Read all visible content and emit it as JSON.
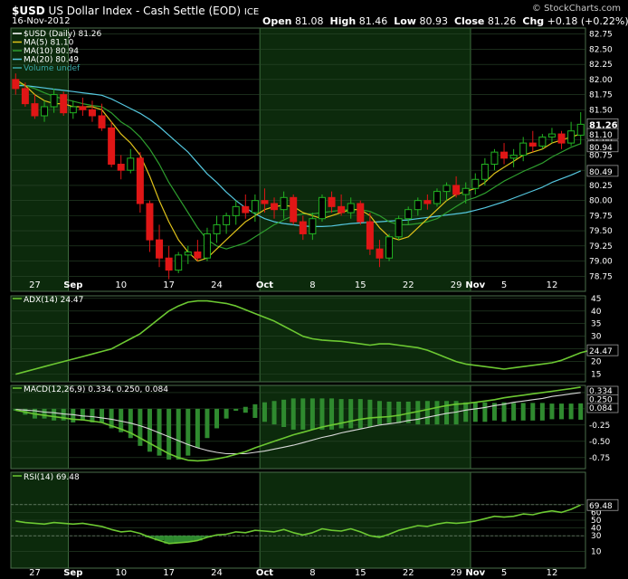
{
  "header": {
    "symbol": "$USD",
    "name": "US Dollar Index - Cash Settle (EOD)",
    "exchange": "ICE",
    "date": "16-Nov-2012",
    "open_label": "Open",
    "open_value": "81.08",
    "high_label": "High",
    "high_value": "81.46",
    "low_label": "Low",
    "low_value": "80.93",
    "close_label": "Close",
    "close_value": "81.26",
    "chg_label": "Chg",
    "chg_value": "+0.18 (+0.22%)",
    "watermark": "© StockCharts.com"
  },
  "colors": {
    "up": "#22b422",
    "down": "#e01616",
    "ma5": "#e0c21a",
    "ma10": "#2e9e2e",
    "ma20": "#55c8e0",
    "indicator": "#6cc832",
    "signal": "#d8d8d8",
    "grid": "#2a472a",
    "shade": "#0c2a0c"
  },
  "chart_data": [
    {
      "type": "candlestick",
      "title": "$USD (Daily) 81.26",
      "legend": [
        {
          "label": "$USD (Daily) 81.26",
          "color": "#ffffff"
        },
        {
          "label": "MA(5) 81.10",
          "color": "#e0c21a"
        },
        {
          "label": "MA(10) 80.94",
          "color": "#2e9e2e"
        },
        {
          "label": "MA(20) 80.49",
          "color": "#55c8e0"
        },
        {
          "label": "Volume undef",
          "color": "#3aa6a6"
        }
      ],
      "ylim": [
        78.5,
        82.85
      ],
      "yticks": [
        "82.75",
        "82.50",
        "82.25",
        "82.00",
        "81.75",
        "81.50",
        "81.25",
        "81.00",
        "80.75",
        "80.50",
        "80.25",
        "80.00",
        "79.75",
        "79.50",
        "79.25",
        "79.00",
        "78.75"
      ],
      "value_tags": [
        {
          "label": "81.26",
          "value": 81.26,
          "bold": true
        },
        {
          "label": "81.10",
          "value": 81.1
        },
        {
          "label": "80.94",
          "value": 80.94
        },
        {
          "label": "80.49",
          "value": 80.49
        }
      ],
      "x_labels": [
        {
          "label": "27",
          "i": 2
        },
        {
          "label": "Sep",
          "i": 6
        },
        {
          "label": "10",
          "i": 11
        },
        {
          "label": "17",
          "i": 16
        },
        {
          "label": "24",
          "i": 21
        },
        {
          "label": "Oct",
          "i": 26
        },
        {
          "label": "8",
          "i": 31
        },
        {
          "label": "15",
          "i": 36
        },
        {
          "label": "22",
          "i": 41
        },
        {
          "label": "29",
          "i": 46
        },
        {
          "label": "Nov",
          "i": 48
        },
        {
          "label": "5",
          "i": 51
        },
        {
          "label": "12",
          "i": 56
        }
      ],
      "ohlc": [
        [
          82.0,
          82.1,
          81.75,
          81.85
        ],
        [
          81.85,
          81.95,
          81.55,
          81.6
        ],
        [
          81.6,
          81.75,
          81.35,
          81.4
        ],
        [
          81.4,
          81.65,
          81.3,
          81.55
        ],
        [
          81.55,
          81.85,
          81.45,
          81.75
        ],
        [
          81.75,
          81.8,
          81.4,
          81.45
        ],
        [
          81.45,
          81.65,
          81.35,
          81.55
        ],
        [
          81.55,
          81.7,
          81.4,
          81.5
        ],
        [
          81.5,
          81.65,
          81.3,
          81.4
        ],
        [
          81.4,
          81.6,
          81.15,
          81.2
        ],
        [
          81.2,
          81.3,
          80.55,
          80.6
        ],
        [
          80.6,
          80.75,
          80.35,
          80.5
        ],
        [
          80.5,
          80.85,
          80.45,
          80.7
        ],
        [
          80.7,
          80.8,
          79.8,
          79.95
        ],
        [
          79.95,
          80.0,
          79.15,
          79.35
        ],
        [
          79.35,
          79.6,
          78.9,
          79.05
        ],
        [
          79.05,
          79.25,
          78.7,
          78.85
        ],
        [
          78.85,
          79.15,
          78.8,
          79.1
        ],
        [
          79.1,
          79.25,
          78.95,
          79.15
        ],
        [
          79.15,
          79.35,
          79.0,
          79.05
        ],
        [
          79.05,
          79.55,
          79.0,
          79.45
        ],
        [
          79.45,
          79.75,
          79.3,
          79.6
        ],
        [
          79.6,
          79.8,
          79.45,
          79.75
        ],
        [
          79.75,
          80.0,
          79.6,
          79.9
        ],
        [
          79.9,
          80.1,
          79.7,
          79.8
        ],
        [
          79.8,
          80.1,
          79.65,
          80.0
        ],
        [
          80.0,
          80.2,
          79.8,
          79.95
        ],
        [
          79.95,
          80.05,
          79.7,
          79.85
        ],
        [
          79.85,
          80.15,
          79.7,
          80.05
        ],
        [
          80.05,
          80.1,
          79.6,
          79.65
        ],
        [
          79.65,
          79.75,
          79.35,
          79.45
        ],
        [
          79.45,
          79.8,
          79.35,
          79.7
        ],
        [
          79.7,
          80.1,
          79.65,
          80.05
        ],
        [
          80.05,
          80.15,
          79.8,
          79.9
        ],
        [
          79.9,
          80.1,
          79.75,
          79.8
        ],
        [
          79.8,
          80.05,
          79.7,
          79.95
        ],
        [
          79.95,
          80.0,
          79.6,
          79.65
        ],
        [
          79.65,
          79.8,
          79.1,
          79.2
        ],
        [
          79.2,
          79.35,
          78.9,
          79.05
        ],
        [
          79.05,
          79.45,
          79.0,
          79.4
        ],
        [
          79.4,
          79.75,
          79.35,
          79.7
        ],
        [
          79.7,
          79.9,
          79.6,
          79.85
        ],
        [
          79.85,
          80.05,
          79.75,
          80.0
        ],
        [
          80.0,
          80.1,
          79.85,
          79.95
        ],
        [
          79.95,
          80.2,
          79.9,
          80.15
        ],
        [
          80.15,
          80.3,
          80.0,
          80.25
        ],
        [
          80.25,
          80.4,
          80.05,
          80.1
        ],
        [
          80.1,
          80.3,
          79.95,
          80.2
        ],
        [
          80.2,
          80.45,
          80.1,
          80.35
        ],
        [
          80.35,
          80.7,
          80.25,
          80.6
        ],
        [
          80.6,
          80.85,
          80.5,
          80.8
        ],
        [
          80.8,
          80.95,
          80.6,
          80.7
        ],
        [
          80.7,
          80.85,
          80.55,
          80.75
        ],
        [
          80.75,
          81.05,
          80.65,
          80.95
        ],
        [
          80.95,
          81.15,
          80.8,
          80.9
        ],
        [
          80.9,
          81.1,
          80.85,
          81.05
        ],
        [
          81.05,
          81.2,
          80.95,
          81.1
        ],
        [
          81.1,
          81.15,
          80.85,
          80.95
        ],
        [
          80.95,
          81.3,
          80.9,
          81.15
        ],
        [
          81.08,
          81.46,
          80.93,
          81.26
        ]
      ],
      "ma5": [
        82.0,
        81.9,
        81.75,
        81.65,
        81.6,
        81.6,
        81.55,
        81.55,
        81.55,
        81.5,
        81.3,
        81.1,
        80.95,
        80.75,
        80.4,
        80.0,
        79.65,
        79.35,
        79.15,
        79.0,
        79.05,
        79.2,
        79.35,
        79.5,
        79.65,
        79.75,
        79.85,
        79.9,
        79.92,
        79.9,
        79.8,
        79.75,
        79.7,
        79.75,
        79.8,
        79.85,
        79.85,
        79.75,
        79.55,
        79.4,
        79.35,
        79.4,
        79.55,
        79.7,
        79.85,
        80.0,
        80.1,
        80.15,
        80.2,
        80.3,
        80.45,
        80.55,
        80.65,
        80.75,
        80.8,
        80.85,
        80.95,
        81.0,
        81.05,
        81.1
      ],
      "ma10": [
        81.95,
        81.9,
        81.85,
        81.78,
        81.72,
        81.68,
        81.64,
        81.6,
        81.57,
        81.55,
        81.45,
        81.3,
        81.2,
        81.05,
        80.85,
        80.6,
        80.3,
        80.05,
        79.8,
        79.55,
        79.35,
        79.25,
        79.2,
        79.25,
        79.3,
        79.4,
        79.5,
        79.6,
        79.68,
        79.75,
        79.78,
        79.78,
        79.8,
        79.82,
        79.84,
        79.85,
        79.85,
        79.82,
        79.75,
        79.65,
        79.6,
        79.6,
        79.62,
        79.65,
        79.7,
        79.8,
        79.9,
        80.0,
        80.05,
        80.12,
        80.22,
        80.32,
        80.4,
        80.48,
        80.55,
        80.62,
        80.72,
        80.8,
        80.88,
        80.94
      ],
      "ma20": [
        81.9,
        81.9,
        81.88,
        81.86,
        81.84,
        81.82,
        81.8,
        81.78,
        81.76,
        81.74,
        81.68,
        81.6,
        81.52,
        81.44,
        81.34,
        81.22,
        81.08,
        80.94,
        80.8,
        80.62,
        80.44,
        80.3,
        80.14,
        80.0,
        79.88,
        79.78,
        79.7,
        79.65,
        79.62,
        79.6,
        79.58,
        79.57,
        79.57,
        79.58,
        79.6,
        79.62,
        79.63,
        79.64,
        79.65,
        79.66,
        79.67,
        79.68,
        79.7,
        79.72,
        79.74,
        79.76,
        79.78,
        79.8,
        79.84,
        79.88,
        79.93,
        79.98,
        80.04,
        80.1,
        80.16,
        80.22,
        80.3,
        80.36,
        80.42,
        80.49
      ]
    },
    {
      "type": "line",
      "title": "ADX(14) 24.47",
      "legend": [
        {
          "label": "ADX(14) 24.47",
          "color": "#6cc832"
        }
      ],
      "ylim": [
        12,
        46
      ],
      "yticks": [
        "45",
        "40",
        "35",
        "30",
        "25",
        "20",
        "15"
      ],
      "value_tags": [
        {
          "label": "24.47",
          "value": 24.47
        }
      ],
      "values": [
        15,
        16,
        17,
        18,
        19,
        20,
        21,
        22,
        23,
        24,
        25,
        27,
        29,
        31,
        34,
        37,
        40,
        42,
        43.5,
        44,
        44,
        43.5,
        43,
        42,
        40.5,
        39,
        37.5,
        36,
        34,
        32,
        30,
        29,
        28.5,
        28.2,
        28,
        27.5,
        27,
        26.5,
        27,
        27,
        26.5,
        26,
        25.5,
        24.5,
        23,
        21.5,
        20,
        19,
        18.5,
        18,
        17.5,
        17,
        17.5,
        18,
        18.5,
        19,
        19.5,
        20.5,
        22,
        23.5,
        24.5
      ]
    },
    {
      "type": "line",
      "title": "MACD(12,26,9) 0.334, 0.250, 0.084",
      "legend": [
        {
          "label": "MACD(12,26,9) 0.334, 0.250, 0.084",
          "color": "#6cc832"
        }
      ],
      "ylim": [
        -0.92,
        0.36
      ],
      "yticks": [
        "0.25",
        "0.00",
        "-0.25",
        "-0.50",
        "-0.75"
      ],
      "value_tags": [
        {
          "label": "0.334",
          "value": 0.334
        },
        {
          "label": "0.250",
          "value": 0.25
        },
        {
          "label": "0.084",
          "value": 0.084
        }
      ],
      "macd": [
        -0.02,
        -0.05,
        -0.08,
        -0.1,
        -0.12,
        -0.14,
        -0.16,
        -0.17,
        -0.19,
        -0.21,
        -0.26,
        -0.31,
        -0.37,
        -0.45,
        -0.53,
        -0.61,
        -0.69,
        -0.75,
        -0.79,
        -0.8,
        -0.79,
        -0.77,
        -0.74,
        -0.7,
        -0.66,
        -0.6,
        -0.55,
        -0.5,
        -0.45,
        -0.4,
        -0.36,
        -0.32,
        -0.28,
        -0.25,
        -0.22,
        -0.19,
        -0.16,
        -0.14,
        -0.13,
        -0.12,
        -0.1,
        -0.07,
        -0.04,
        -0.01,
        0.02,
        0.05,
        0.07,
        0.08,
        0.1,
        0.12,
        0.14,
        0.17,
        0.19,
        0.21,
        0.23,
        0.25,
        0.27,
        0.29,
        0.31,
        0.334
      ],
      "signal": [
        -0.01,
        -0.02,
        -0.03,
        -0.05,
        -0.06,
        -0.08,
        -0.09,
        -0.11,
        -0.12,
        -0.14,
        -0.16,
        -0.19,
        -0.22,
        -0.26,
        -0.31,
        -0.37,
        -0.43,
        -0.49,
        -0.55,
        -0.6,
        -0.64,
        -0.67,
        -0.69,
        -0.69,
        -0.69,
        -0.67,
        -0.65,
        -0.62,
        -0.59,
        -0.56,
        -0.52,
        -0.48,
        -0.44,
        -0.41,
        -0.37,
        -0.34,
        -0.31,
        -0.28,
        -0.25,
        -0.23,
        -0.21,
        -0.18,
        -0.16,
        -0.13,
        -0.1,
        -0.07,
        -0.05,
        -0.02,
        0.0,
        0.02,
        0.05,
        0.07,
        0.1,
        0.12,
        0.14,
        0.16,
        0.19,
        0.21,
        0.23,
        0.25
      ],
      "histogram_note": "histogram = macd - signal"
    },
    {
      "type": "line",
      "title": "RSI(14) 69.48",
      "legend": [
        {
          "label": "RSI(14) 69.48",
          "color": "#6cc832"
        }
      ],
      "ylim": [
        0,
        100
      ],
      "yticks": [
        "70",
        "60",
        "50",
        "40",
        "30",
        "10"
      ],
      "reference_lines": [
        70,
        30
      ],
      "value_tags": [
        {
          "label": "69.48",
          "value": 69.48
        }
      ],
      "values": [
        49,
        47,
        46,
        45,
        47,
        46,
        45,
        46,
        44,
        42,
        38,
        35,
        36,
        33,
        28,
        24,
        20,
        21,
        22,
        24,
        28,
        31,
        32,
        35,
        34,
        37,
        36,
        35,
        38,
        34,
        31,
        34,
        39,
        37,
        36,
        39,
        35,
        30,
        28,
        32,
        37,
        40,
        43,
        42,
        45,
        47,
        46,
        47,
        49,
        52,
        55,
        54,
        55,
        58,
        57,
        60,
        62,
        60,
        64,
        69.48
      ]
    }
  ]
}
